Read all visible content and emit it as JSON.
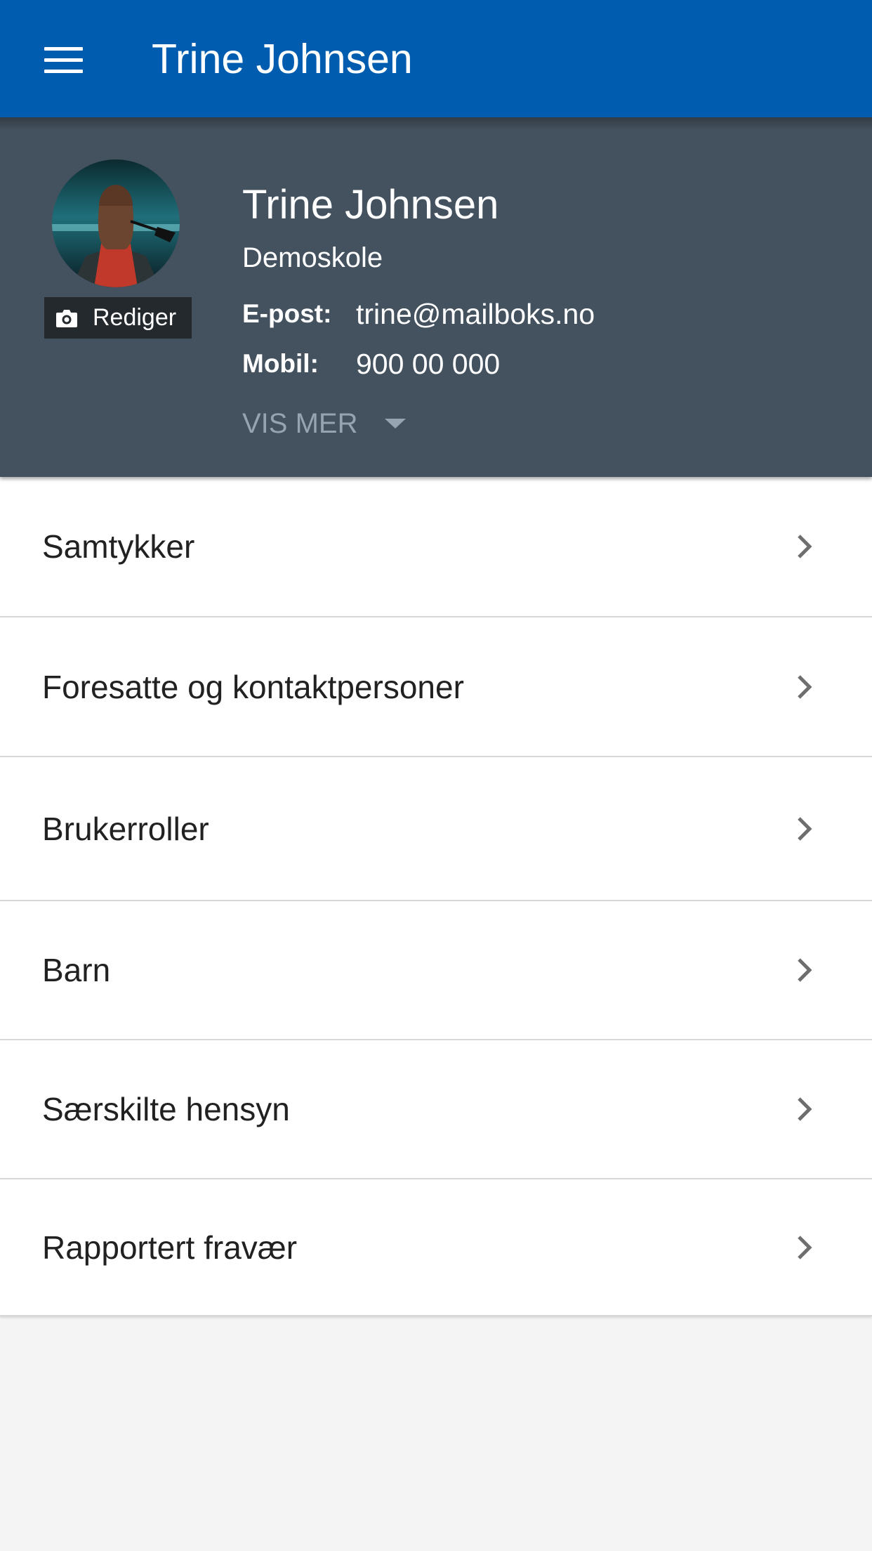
{
  "app_bar": {
    "title": "Trine Johnsen",
    "menu_icon": "hamburger-menu-icon"
  },
  "profile": {
    "name": "Trine Johnsen",
    "school": "Demoskole",
    "edit_label": "Rediger",
    "edit_icon": "camera-icon",
    "email_label": "E-post:",
    "email_value": "trine@mailboks.no",
    "mobile_label": "Mobil:",
    "mobile_value": "900 00 000",
    "show_more_label": "VIS MER",
    "show_more_icon": "caret-down-icon"
  },
  "menu": {
    "items": [
      {
        "label": "Samtykker"
      },
      {
        "label": "Foresatte og kontaktpersoner"
      },
      {
        "label": "Brukerroller"
      },
      {
        "label": "Barn"
      },
      {
        "label": "Særskilte hensyn"
      },
      {
        "label": "Rapportert fravær"
      }
    ],
    "item_icon": "chevron-right-icon"
  },
  "colors": {
    "app_bar": "#005cae",
    "profile_background": "#44525f",
    "show_more": "#96a3b0",
    "page_background": "#f4f4f4"
  }
}
